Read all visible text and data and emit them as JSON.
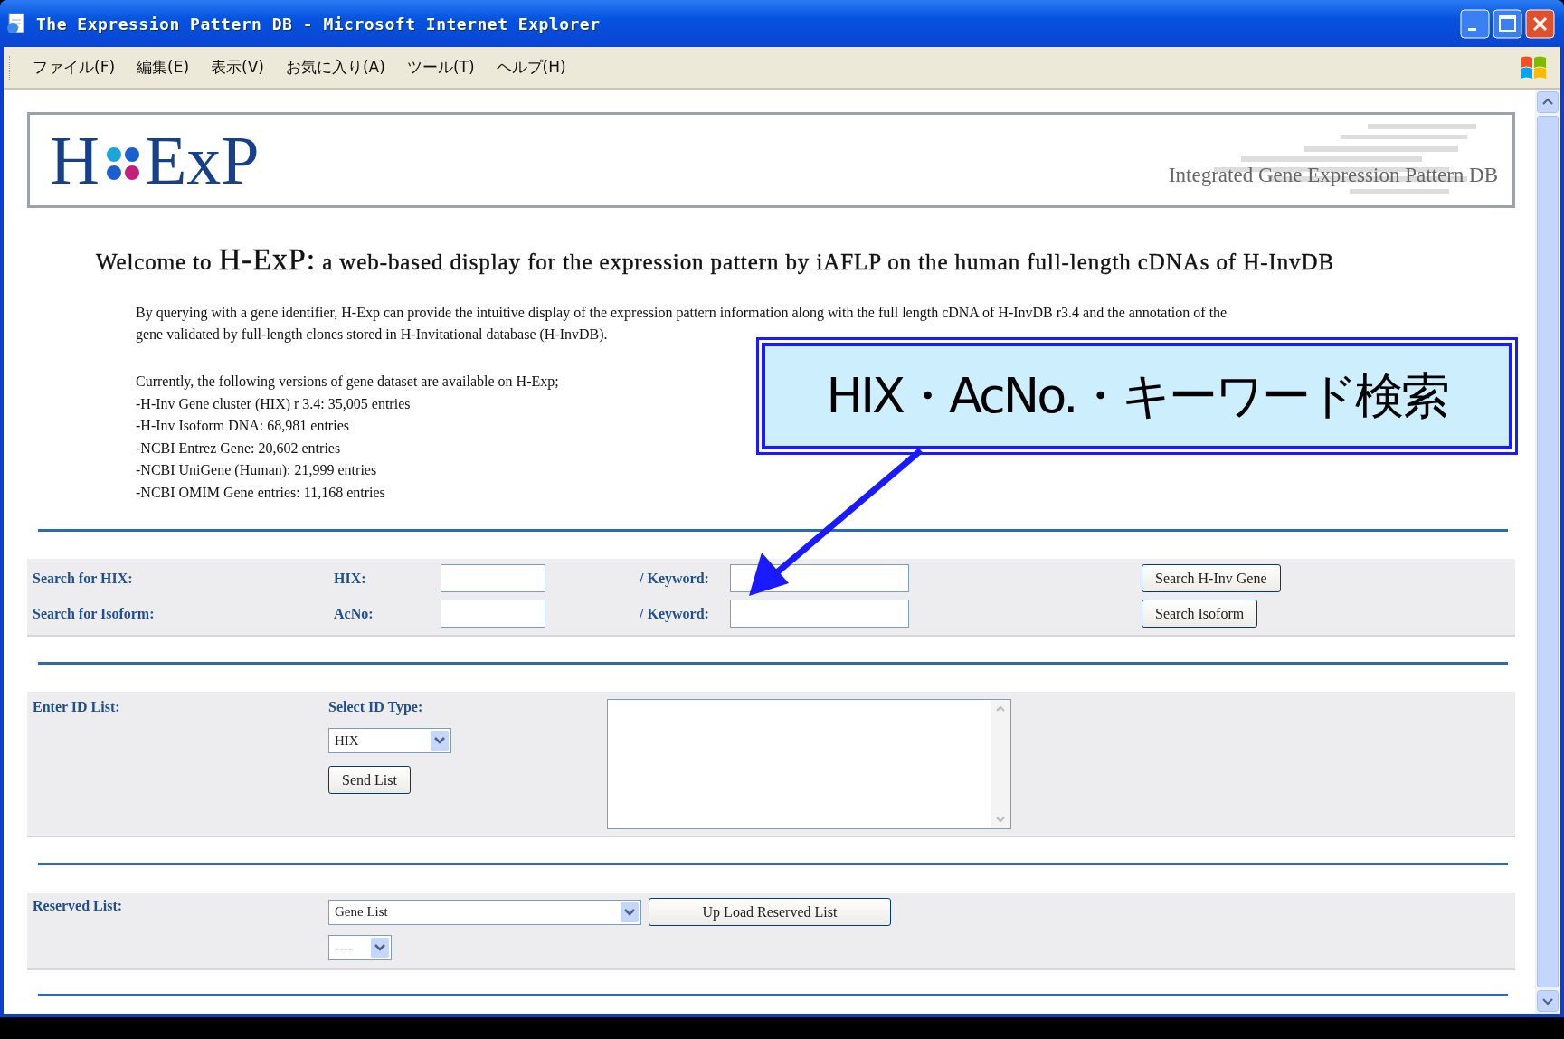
{
  "window": {
    "title": "The Expression Pattern DB - Microsoft Internet Explorer"
  },
  "menu": [
    "ファイル(F)",
    "編集(E)",
    "表示(V)",
    "お気に入り(A)",
    "ツール(T)",
    "ヘルプ(H)"
  ],
  "header": {
    "logo_left": "H",
    "logo_right": "ExP",
    "tagline": "Integrated Gene Expression Pattern DB"
  },
  "welcome": {
    "prefix": "Welcome to ",
    "name": "H-ExP:",
    "suffix": " a web-based display for the expression pattern by iAFLP on the human full-length cDNAs of H-InvDB"
  },
  "intro": "By querying with a gene identifier, H-Exp can provide the intuitive display of the expression pattern information along with the full length cDNA of H-InvDB r3.4 and the annotation of the gene validated by full-length clones stored in H-Invitational database (H-InvDB).",
  "versions": {
    "lead": "Currently, the following versions of gene dataset are available on H-Exp;",
    "items": [
      "-H-Inv Gene cluster (HIX) r 3.4: 35,005 entries",
      "-H-Inv Isoform DNA: 68,981 entries",
      "-NCBI Entrez Gene: 20,602 entries",
      "-NCBI UniGene (Human): 21,999 entries",
      "-NCBI OMIM Gene entries: 11,168 entries"
    ]
  },
  "search_rows": [
    {
      "label": "Search for HIX:",
      "id_label": "HIX:",
      "keyword_label": "/ Keyword:",
      "button": "Search H-Inv Gene"
    },
    {
      "label": "Search for Isoform:",
      "id_label": "AcNo:",
      "keyword_label": "/ Keyword:",
      "button": "Search Isoform"
    }
  ],
  "id_list": {
    "label": "Enter ID List:",
    "type_label": "Select ID Type:",
    "type_value": "HIX",
    "button": "Send List"
  },
  "reserved": {
    "label": "Reserved List:",
    "list_value": "Gene List",
    "button": "Up Load Reserved List",
    "sub_value": "----"
  },
  "callout": {
    "text": "HIX・AcNo.・キーワード検索"
  }
}
